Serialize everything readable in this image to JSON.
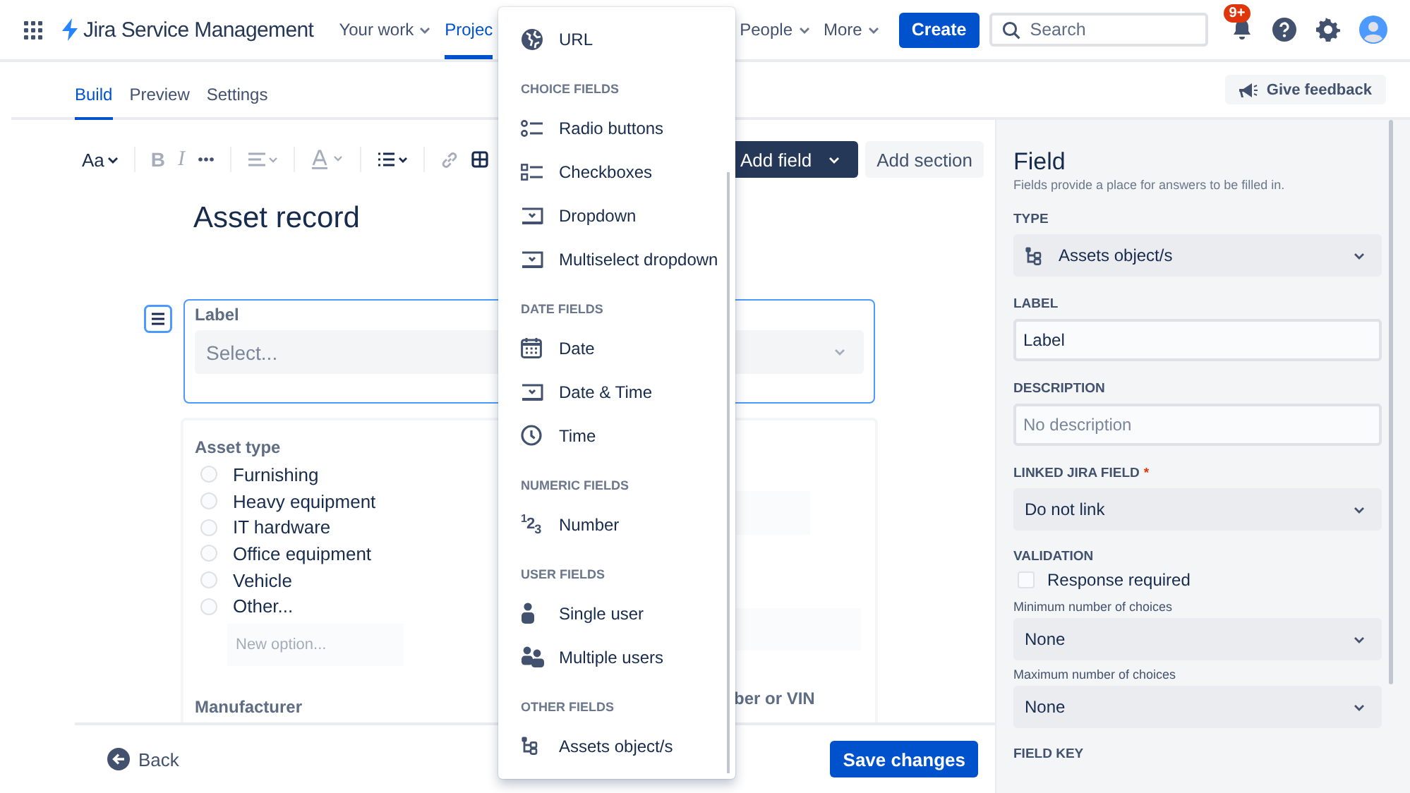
{
  "nav": {
    "product": "Jira Service Management",
    "items": [
      {
        "label": "Your work",
        "selected": false,
        "caret": true
      },
      {
        "label": "Projec",
        "selected": true,
        "caret": false
      },
      {
        "label": "People",
        "selected": false,
        "caret": true
      },
      {
        "label": "More",
        "selected": false,
        "caret": true
      }
    ],
    "create": "Create",
    "search": {
      "placeholder": "Search"
    },
    "notification_badge": "9+"
  },
  "tabs": [
    {
      "label": "Build",
      "selected": true
    },
    {
      "label": "Preview",
      "selected": false
    },
    {
      "label": "Settings",
      "selected": false
    }
  ],
  "feedback_button": "Give feedback",
  "toolbar": {
    "font_menu": "Aa",
    "bold": "B",
    "italic": "I",
    "add_field": "Add field",
    "add_section": "Add section"
  },
  "form": {
    "title": "Asset record",
    "label_field": {
      "label": "Label",
      "placeholder": "Select...",
      "selected": true
    },
    "section": {
      "label": "Asset type",
      "options": [
        {
          "label": "Furnishing",
          "selected": false
        },
        {
          "label": "Heavy equipment",
          "selected": false
        },
        {
          "label": "IT hardware",
          "selected": false
        },
        {
          "label": "Office equipment",
          "selected": false
        },
        {
          "label": "Vehicle",
          "selected": false
        },
        {
          "label": "Other...",
          "selected": false
        }
      ],
      "new_option": {
        "placeholder": "New option..."
      },
      "next_label": "Manufacturer",
      "right_label": "ber or VIN"
    }
  },
  "footer": {
    "back": "Back",
    "save": "Save changes"
  },
  "menu": {
    "groups": [
      {
        "items": [
          {
            "kind": "url",
            "label": "URL"
          }
        ]
      },
      {
        "header": "CHOICE FIELDS",
        "items": [
          {
            "kind": "radio",
            "label": "Radio buttons"
          },
          {
            "kind": "checkbox",
            "label": "Checkboxes"
          },
          {
            "kind": "dropdown",
            "label": "Dropdown"
          },
          {
            "kind": "dropdown",
            "label": "Multiselect dropdown"
          }
        ]
      },
      {
        "header": "DATE FIELDS",
        "items": [
          {
            "kind": "date",
            "label": "Date"
          },
          {
            "kind": "dropdown",
            "label": "Date & Time"
          },
          {
            "kind": "time",
            "label": "Time"
          }
        ]
      },
      {
        "header": "NUMERIC FIELDS",
        "items": [
          {
            "kind": "number",
            "glyph": "$^{1}$2$_{3}$",
            "label": "Number"
          }
        ]
      },
      {
        "header": "USER FIELDS",
        "items": [
          {
            "kind": "user",
            "label": "Single user"
          },
          {
            "kind": "users",
            "label": "Multiple users"
          }
        ]
      },
      {
        "header": "OTHER FIELDS",
        "items": [
          {
            "kind": "assets",
            "label": "Assets object/s"
          }
        ]
      }
    ]
  },
  "panel": {
    "title": "Field",
    "description": "Fields provide a place for answers to be filled in.",
    "fields": [
      {
        "kind": "typeselect",
        "label": "TYPE",
        "value": "Assets object/s"
      },
      {
        "kind": "input",
        "label": "LABEL",
        "value": "Label"
      },
      {
        "kind": "input",
        "label": "DESCRIPTION",
        "placeholder": "No description"
      },
      {
        "kind": "select",
        "label": "LINKED JIRA FIELD",
        "required_mark": "*",
        "value": "Do not link"
      },
      {
        "kind": "heading",
        "label": "VALIDATION"
      },
      {
        "kind": "checkbox",
        "label": "Response required",
        "checked": false
      },
      {
        "kind": "select",
        "caption": "Minimum number of choices",
        "value": "None"
      },
      {
        "kind": "select",
        "caption": "Maximum number of choices",
        "value": "None"
      },
      {
        "kind": "heading",
        "label": "FIELD KEY"
      }
    ]
  }
}
